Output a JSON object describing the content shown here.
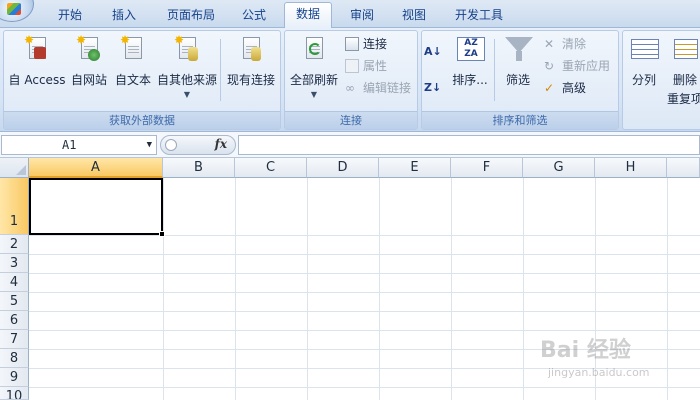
{
  "tabs": [
    "开始",
    "插入",
    "页面布局",
    "公式",
    "数据",
    "审阅",
    "视图",
    "开发工具"
  ],
  "active_tab": "数据",
  "ribbon": {
    "get_external": {
      "label": "获取外部数据",
      "buttons": [
        "自 Access",
        "自网站",
        "自文本",
        "自其他来源",
        "现有连接"
      ]
    },
    "connections": {
      "label": "连接",
      "refresh_all": "全部刷新",
      "connect": "连接",
      "properties": "属性",
      "edit_links": "编辑链接"
    },
    "sort_filter": {
      "label": "排序和筛选",
      "sort": "排序...",
      "filter": "筛选",
      "clear": "清除",
      "reapply": "重新应用",
      "advanced": "高级"
    },
    "data_tools": {
      "split": "分列",
      "remove_dup": "删除",
      "remove_dup_line2": "重复项"
    }
  },
  "formula_bar": {
    "name_box": "A1",
    "fx": "fx",
    "value": ""
  },
  "grid": {
    "columns": [
      "A",
      "B",
      "C",
      "D",
      "E",
      "F",
      "G",
      "H"
    ],
    "rows": [
      "1",
      "2",
      "3",
      "4",
      "5",
      "6",
      "7",
      "8",
      "9",
      "10"
    ],
    "selected_cell": "A1"
  },
  "watermark": {
    "text": "Bai 经验",
    "url": "jingyan.baidu.com"
  }
}
